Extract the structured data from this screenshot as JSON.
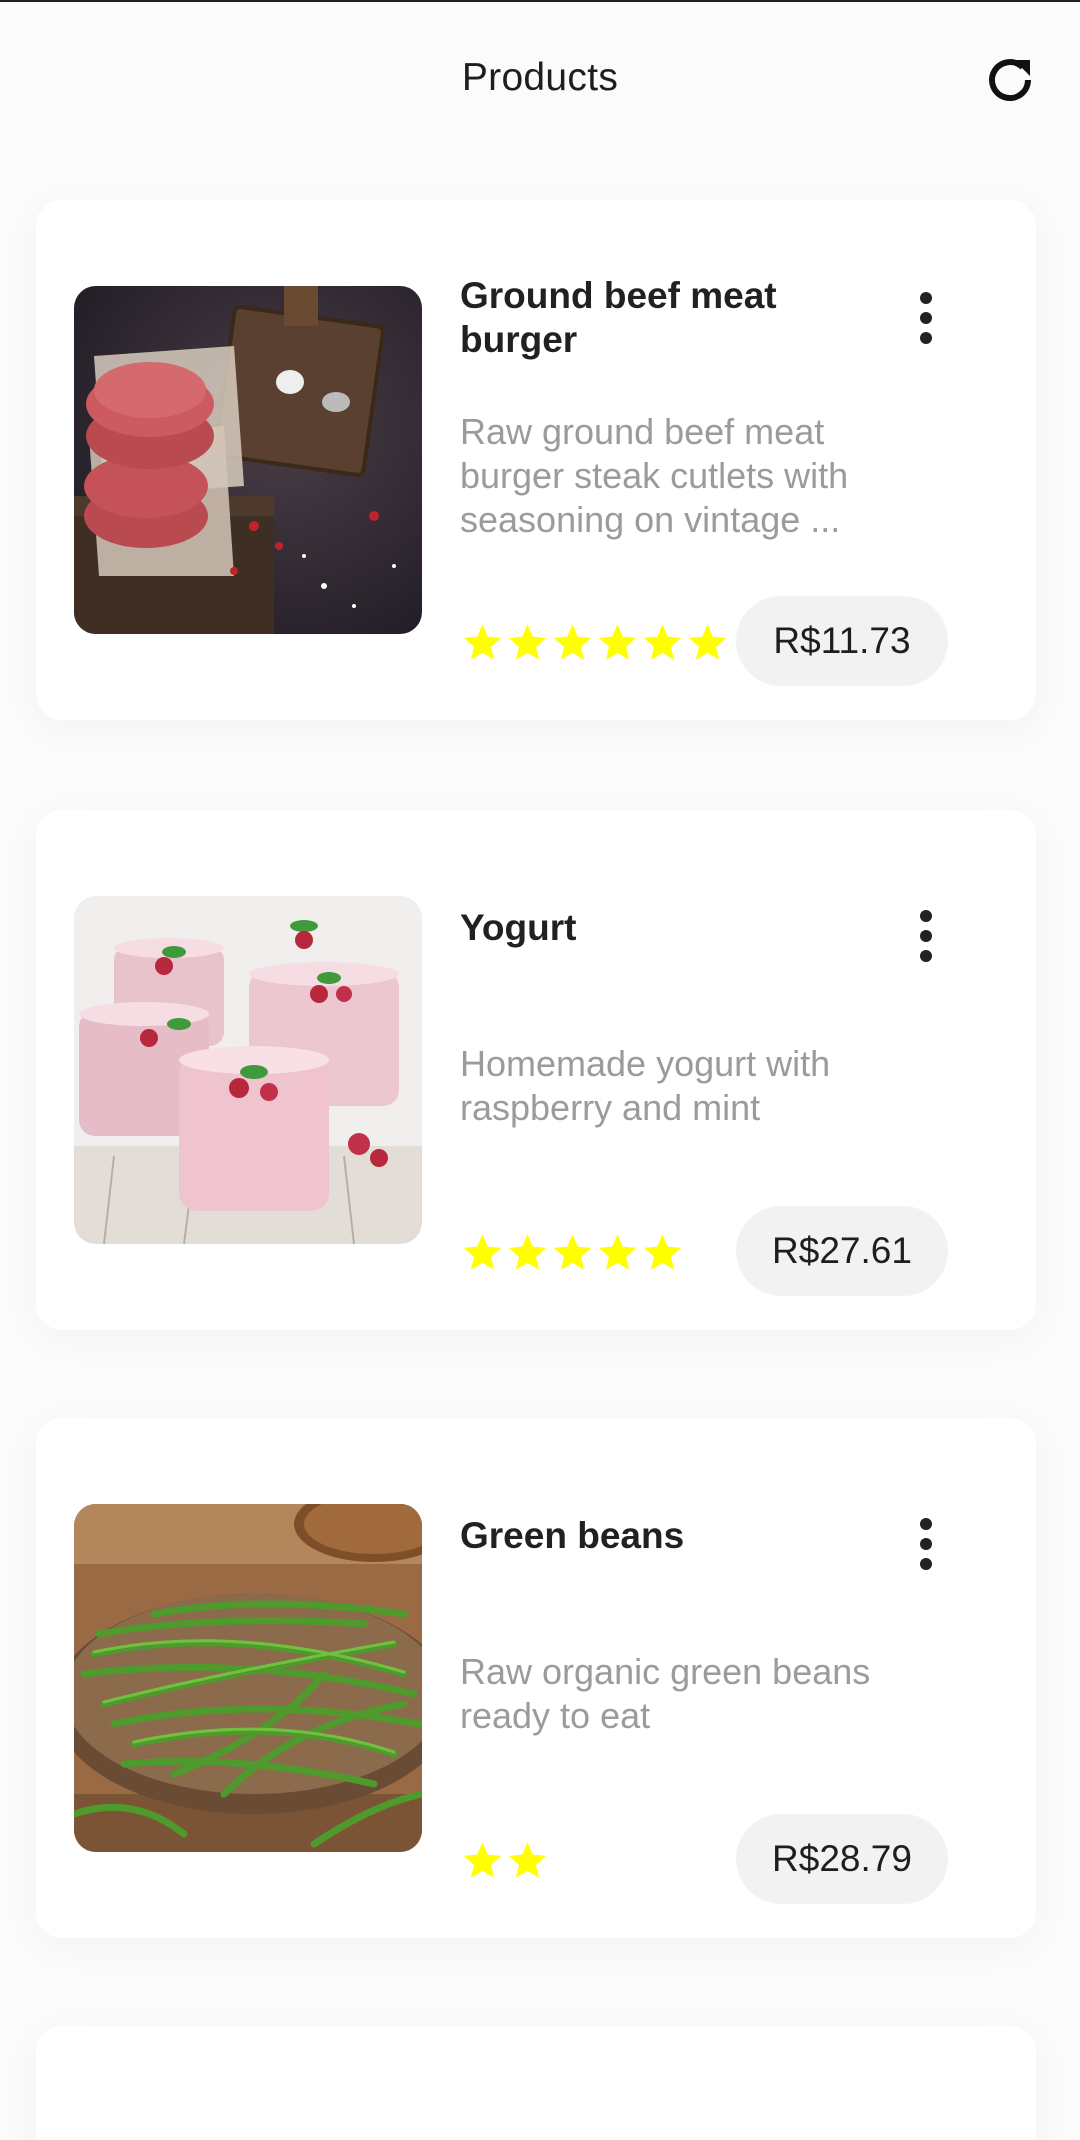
{
  "app_bar": {
    "title": "Products",
    "refresh_icon": "refresh-icon"
  },
  "colors": {
    "star": "#ffff00",
    "price_background": "#f2f2f2",
    "description": "#9b9b9b"
  },
  "products": [
    {
      "name": "Ground beef meat burger",
      "description": "Raw ground beef meat burger steak cutlets with seasoning on vintage ...",
      "rating": 6,
      "price": "R$11.73",
      "image": "beef-burger-patties-photo"
    },
    {
      "name": "Yogurt",
      "description": "Homemade yogurt with raspberry and mint",
      "rating": 5,
      "price": "R$27.61",
      "image": "raspberry-yogurt-photo"
    },
    {
      "name": "Green beans",
      "description": "Raw organic green beans ready to eat",
      "rating": 2,
      "price": "R$28.79",
      "image": "green-beans-photo"
    }
  ]
}
